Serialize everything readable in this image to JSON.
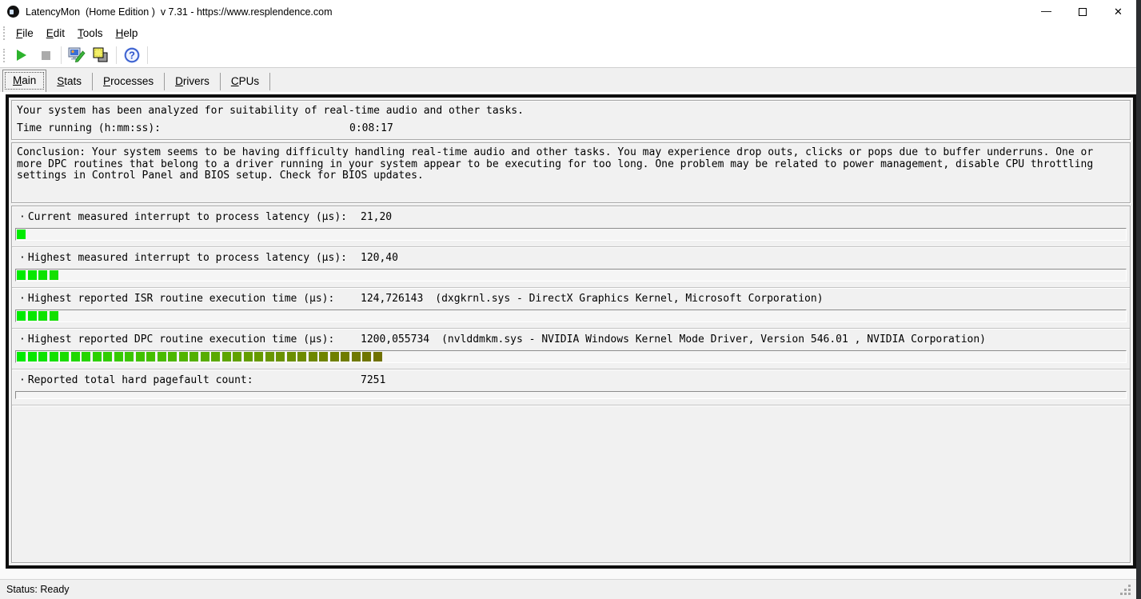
{
  "window": {
    "title": "LatencyMon  (Home Edition )  v 7.31 - https://www.resplendence.com",
    "minimize_glyph": "—",
    "close_glyph": "✕"
  },
  "menu": {
    "items": [
      "File",
      "Edit",
      "Tools",
      "Help"
    ]
  },
  "toolbar": {
    "buttons": [
      {
        "name": "start-monitor",
        "icon": "play-icon",
        "disabled": false
      },
      {
        "name": "stop-monitor",
        "icon": "stop-icon",
        "disabled": true
      },
      {
        "name": "edit-options",
        "icon": "monitor-pencil-icon",
        "disabled": false
      },
      {
        "name": "latency-tests",
        "icon": "overlapping-squares-icon",
        "disabled": false
      },
      {
        "name": "help",
        "icon": "question-mark-icon",
        "disabled": false
      }
    ],
    "help_glyph": "?"
  },
  "tabs": [
    {
      "label": "Main",
      "active": true
    },
    {
      "label": "Stats",
      "active": false
    },
    {
      "label": "Processes",
      "active": false
    },
    {
      "label": "Drivers",
      "active": false
    },
    {
      "label": "CPUs",
      "active": false
    }
  ],
  "analysis": {
    "headline": "Your system has been analyzed for suitability of real-time audio and other tasks.",
    "time_label": "Time running (h:mm:ss):",
    "time_value": "0:08:17"
  },
  "conclusion": "Conclusion: Your system seems to be having difficulty handling real-time audio and other tasks. You may experience drop outs, clicks or pops due to buffer underruns. One or more DPC routines that belong to a driver running in your system appear to be executing for too long. One problem may be related to power management, disable CPU throttling settings in Control Panel and BIOS setup. Check for BIOS updates.",
  "measurement_bullet": "·",
  "measurements": [
    {
      "label": "Current measured interrupt to process latency (µs):",
      "value": "21,20",
      "detail": "",
      "segments": 1
    },
    {
      "label": "Highest measured interrupt to process latency (µs):",
      "value": "120,40",
      "detail": "",
      "segments": 4
    },
    {
      "label": "Highest reported ISR routine execution time (µs):",
      "value": "124,726143",
      "detail": "(dxgkrnl.sys - DirectX Graphics Kernel, Microsoft Corporation)",
      "segments": 4
    },
    {
      "label": "Highest reported DPC routine execution time (µs):",
      "value": "1200,055734",
      "detail": "(nvlddmkm.sys - NVIDIA Windows Kernel Mode Driver, Version 546.01 , NVIDIA Corporation)",
      "segments": 34
    },
    {
      "label": "Reported total hard pagefault count:",
      "value": "7251",
      "detail": "",
      "segments": 0
    }
  ],
  "bar_gradient": {
    "hue_start": 120,
    "hue_step": 1.8,
    "hue_min": 60,
    "light_start": 46,
    "light_step": 0.72,
    "light_min": 22,
    "start_color": "#00ea00",
    "end_color": "#6b6b00"
  },
  "status_bar": {
    "text": "Status: Ready"
  }
}
